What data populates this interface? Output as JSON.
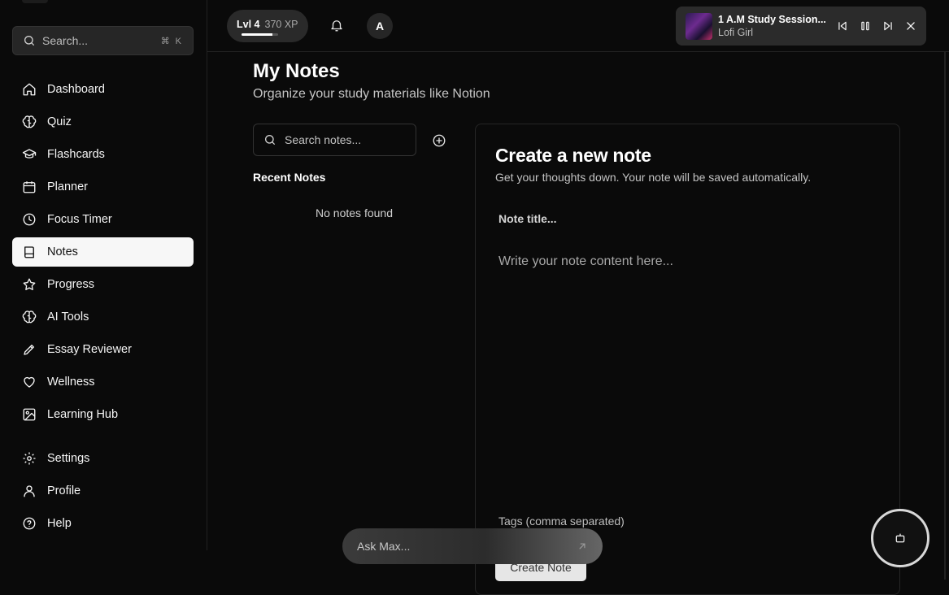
{
  "sidebar": {
    "search_placeholder": "Search...",
    "search_shortcut": "⌘ K",
    "items": [
      {
        "label": "Dashboard",
        "icon": "home-icon"
      },
      {
        "label": "Quiz",
        "icon": "brain-icon"
      },
      {
        "label": "Flashcards",
        "icon": "graduation-cap-icon"
      },
      {
        "label": "Planner",
        "icon": "calendar-icon"
      },
      {
        "label": "Focus Timer",
        "icon": "clock-icon"
      },
      {
        "label": "Notes",
        "icon": "book-icon",
        "active": true
      },
      {
        "label": "Progress",
        "icon": "star-icon"
      },
      {
        "label": "AI Tools",
        "icon": "brain-icon"
      },
      {
        "label": "Essay Reviewer",
        "icon": "pencil-icon"
      },
      {
        "label": "Wellness",
        "icon": "heart-icon"
      },
      {
        "label": "Learning Hub",
        "icon": "image-icon"
      }
    ],
    "bottom_items": [
      {
        "label": "Settings",
        "icon": "gear-icon"
      },
      {
        "label": "Profile",
        "icon": "user-icon"
      },
      {
        "label": "Help",
        "icon": "help-circle-icon"
      }
    ]
  },
  "header": {
    "level": "Lvl 4",
    "xp": "370 XP",
    "xp_progress": 0.85,
    "avatar_initial": "A",
    "player": {
      "title": "1 A.M Study Session...",
      "artist": "Lofi Girl"
    }
  },
  "main": {
    "title": "My Notes",
    "subtitle": "Organize your study materials like Notion",
    "search_placeholder": "Search notes...",
    "recent_label": "Recent Notes",
    "empty_text": "No notes found",
    "editor": {
      "heading": "Create a new note",
      "description": "Get your thoughts down. Your note will be saved automatically.",
      "title_placeholder": "Note title...",
      "content_placeholder": "Write your note content here...",
      "tags_placeholder": "Tags (comma separated)",
      "create_label": "Create Note"
    }
  },
  "assistant": {
    "placeholder": "Ask Max..."
  },
  "colors": {
    "background": "#0a0a0a",
    "active_nav": "#f7f7f7",
    "panel": "#2b2b2b"
  }
}
